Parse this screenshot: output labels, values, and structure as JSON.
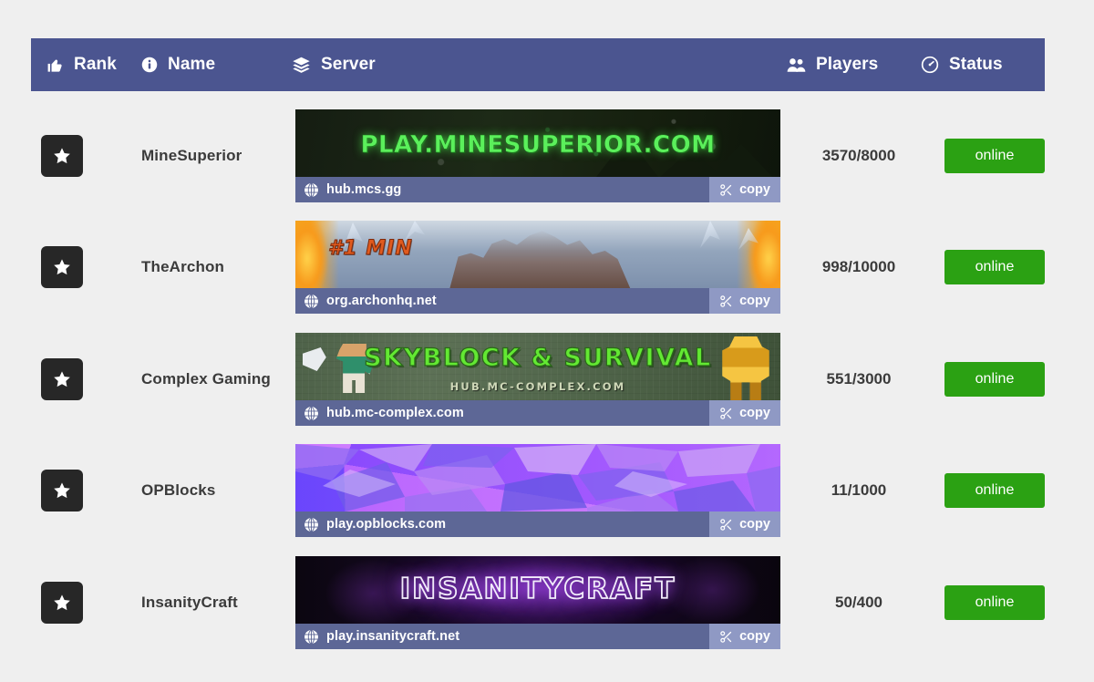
{
  "table": {
    "columns": [
      {
        "key": "rank",
        "label": "Rank",
        "icon": "thumbs-up-icon"
      },
      {
        "key": "name",
        "label": "Name",
        "icon": "info-circle-icon"
      },
      {
        "key": "server",
        "label": "Server",
        "icon": "layers-icon"
      },
      {
        "key": "players",
        "label": "Players",
        "icon": "users-icon"
      },
      {
        "key": "status",
        "label": "Status",
        "icon": "speedometer-icon"
      }
    ],
    "copy_label": "copy",
    "copy_icon": "scissors-icon",
    "address_icon": "globe-icon",
    "rank_icon": "star-icon",
    "rows": [
      {
        "name": "MineSuperior",
        "address": "hub.mcs.gg",
        "banner_text": "PLAY.MINESUPERIOR.COM",
        "banner_subtext": "",
        "players": "3570/8000",
        "status": "online"
      },
      {
        "name": "TheArchon",
        "address": "org.archonhq.net",
        "banner_text": "#1 MIN",
        "banner_subtext": "",
        "players": "998/10000",
        "status": "online"
      },
      {
        "name": "Complex Gaming",
        "address": "hub.mc-complex.com",
        "banner_text": "SKYBLOCK & SURVIVAL",
        "banner_subtext": "HUB.MC-COMPLEX.COM",
        "players": "551/3000",
        "status": "online"
      },
      {
        "name": "OPBlocks",
        "address": "play.opblocks.com",
        "banner_text": "",
        "banner_subtext": "",
        "players": "11/1000",
        "status": "online"
      },
      {
        "name": "InsanityCraft",
        "address": "play.insanitycraft.net",
        "banner_text": "INSANITYCRAFT",
        "banner_subtext": "",
        "players": "50/400",
        "status": "online"
      }
    ]
  },
  "colors": {
    "page_background": "#efefef",
    "header_bar": "#4b5590",
    "address_bar": "#5d6796",
    "copy_button": "#8f99c4",
    "status_online": "#2ba113",
    "rank_badge": "#272727",
    "text_dark": "#3b3b3b"
  }
}
